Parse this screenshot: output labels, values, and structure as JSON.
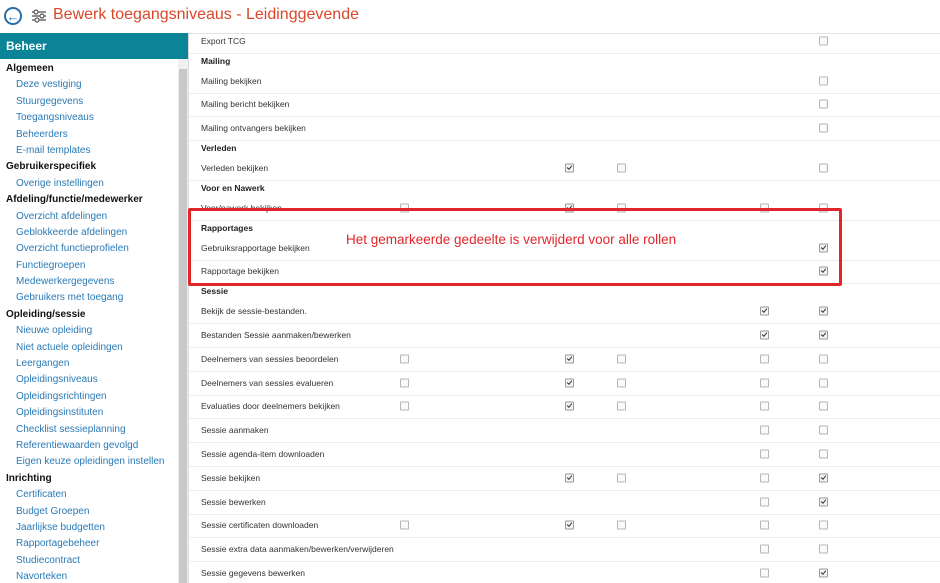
{
  "title": "Bewerk toegangsniveaus - Leidinggevende",
  "sidebar": {
    "header": "Beheer",
    "groups": [
      {
        "label": "Algemeen",
        "items": [
          "Deze vestiging",
          "Stuurgegevens",
          "Toegangsniveaus",
          "Beheerders",
          "E-mail templates"
        ]
      },
      {
        "label": "Gebruikerspecifiek",
        "items": [
          "Overige instellingen"
        ]
      },
      {
        "label": "Afdeling/functie/medewerker",
        "items": [
          "Overzicht afdelingen",
          "Geblokkeerde afdelingen",
          "Overzicht functieprofielen",
          "Functiegroepen",
          "Medewerkergegevens",
          "Gebruikers met toegang"
        ]
      },
      {
        "label": "Opleiding/sessie",
        "items": [
          "Nieuwe opleiding",
          "Niet actuele opleidingen",
          "Leergangen",
          "Opleidingsniveaus",
          "Opleidingsrichtingen",
          "Opleidingsinstituten",
          "Checklist sessieplanning",
          "Referentiewaarden gevolgd",
          "Eigen keuze opleidingen instellen"
        ]
      },
      {
        "label": "Inrichting",
        "items": [
          "Certificaten",
          "Budget Groepen",
          "Jaarlijkse budgetten",
          "Rapportagebeheer",
          "Studiecontract",
          "Navorteken"
        ]
      }
    ]
  },
  "rows": [
    {
      "label": "Export TCG",
      "type": "item",
      "cells": [
        null,
        null,
        null,
        null,
        false
      ]
    },
    {
      "label": "Mailing",
      "type": "section"
    },
    {
      "label": "Mailing bekijken",
      "type": "item",
      "cells": [
        null,
        null,
        null,
        null,
        false
      ]
    },
    {
      "label": "Mailing bericht bekijken",
      "type": "item",
      "cells": [
        null,
        null,
        null,
        null,
        false
      ]
    },
    {
      "label": "Mailing ontvangers bekijken",
      "type": "item",
      "cells": [
        null,
        null,
        null,
        null,
        false
      ]
    },
    {
      "label": "Verleden",
      "type": "section"
    },
    {
      "label": "Verleden bekijken",
      "type": "item",
      "cells": [
        null,
        true,
        false,
        null,
        false
      ]
    },
    {
      "label": "Voor en Nawerk",
      "type": "section"
    },
    {
      "label": "Voor/nawerk bekijken",
      "type": "item",
      "cells": [
        false,
        true,
        false,
        false,
        false
      ]
    },
    {
      "label": "Rapportages",
      "type": "section"
    },
    {
      "label": "Gebruiksrapportage bekijken",
      "type": "item",
      "cells": [
        null,
        null,
        null,
        null,
        true
      ]
    },
    {
      "label": "Rapportage bekijken",
      "type": "item",
      "cells": [
        null,
        null,
        null,
        null,
        true
      ]
    },
    {
      "label": "Sessie",
      "type": "section"
    },
    {
      "label": "Bekijk de sessie-bestanden.",
      "type": "item",
      "cells": [
        null,
        null,
        null,
        true,
        true
      ]
    },
    {
      "label": "Bestanden Sessie aanmaken/bewerken",
      "type": "item",
      "cells": [
        null,
        null,
        null,
        true,
        true
      ]
    },
    {
      "label": "Deelnemers van sessies beoordelen",
      "type": "item",
      "cells": [
        false,
        true,
        false,
        false,
        false
      ]
    },
    {
      "label": "Deelnemers van sessies evalueren",
      "type": "item",
      "cells": [
        false,
        true,
        false,
        false,
        false
      ]
    },
    {
      "label": "Evaluaties door deelnemers bekijken",
      "type": "item",
      "cells": [
        false,
        true,
        false,
        false,
        false
      ]
    },
    {
      "label": "Sessie aanmaken",
      "type": "item",
      "cells": [
        null,
        null,
        null,
        false,
        false
      ]
    },
    {
      "label": "Sessie agenda-item downloaden",
      "type": "item",
      "cells": [
        null,
        null,
        null,
        false,
        false
      ]
    },
    {
      "label": "Sessie bekijken",
      "type": "item",
      "cells": [
        null,
        true,
        false,
        false,
        true
      ]
    },
    {
      "label": "Sessie bewerken",
      "type": "item",
      "cells": [
        null,
        null,
        null,
        false,
        true
      ]
    },
    {
      "label": "Sessie certificaten downloaden",
      "type": "item",
      "cells": [
        false,
        true,
        false,
        false,
        false
      ]
    },
    {
      "label": "Sessie extra data aanmaken/bewerken/verwijderen",
      "type": "item",
      "cells": [
        null,
        null,
        null,
        false,
        false
      ]
    },
    {
      "label": "Sessie gegevens bewerken",
      "type": "item",
      "cells": [
        null,
        null,
        null,
        false,
        true
      ]
    }
  ],
  "annotation": "Het gemarkeerde gedeelte is verwijderd voor alle rollen",
  "colors": {
    "accent": "#0a8496",
    "title": "#d9472b",
    "link": "#2a7ab6",
    "highlight": "#e0262b"
  }
}
